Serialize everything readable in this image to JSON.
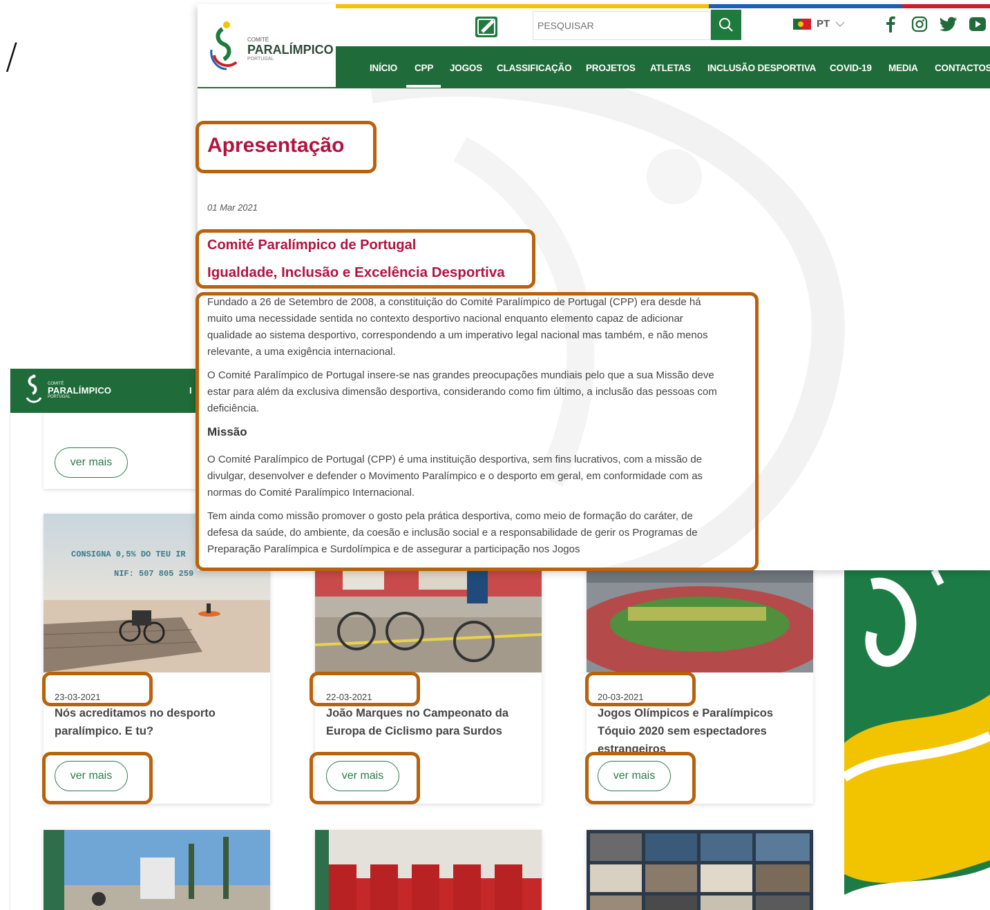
{
  "decor": {
    "slash": "/"
  },
  "background_page": {
    "logo": {
      "small": "COMITÉ",
      "big": "PARALÍMPICO",
      "sub": "PORTUGAL"
    },
    "nav_stub": "I",
    "top_card_button": "ver mais",
    "cards": [
      {
        "date": "23-03-2021",
        "title": "Nós acreditamos no desporto paralímpico. E tu?",
        "button": "ver mais",
        "image_text_1": "CONSIGNA 0,5% DO TEU IR",
        "image_text_2": "NIF: 507 805 259"
      },
      {
        "date": "22-03-2021",
        "title": "João Marques no Campeonato da Europa de Ciclismo para Surdos",
        "button": "ver mais"
      },
      {
        "date": "20-03-2021",
        "title": "Jogos Olímpicos e Paralímpicos Tóquio 2020 sem espectadores estrangeiros",
        "button": "ver mais"
      }
    ]
  },
  "foreground_page": {
    "logo": {
      "small": "COMITÉ",
      "big": "PARALÍMPICO",
      "sub": "PORTUGAL"
    },
    "search": {
      "placeholder": "PESQUISAR"
    },
    "language": "PT",
    "nav": [
      "INÍCIO",
      "CPP",
      "JOGOS",
      "CLASSIFICAÇÃO",
      "PROJETOS",
      "ATLETAS",
      "INCLUSÃO DESPORTIVA",
      "COVID-19",
      "MEDIA",
      "CONTACTOS"
    ],
    "nav_active": "CPP",
    "social_icons": [
      "facebook-icon",
      "instagram-icon",
      "twitter-icon",
      "youtube-icon"
    ],
    "title": "Apresentação",
    "date": "01 Mar 2021",
    "heading": "Comité Paralímpico de Portugal",
    "subheading": "Igualdade, Inclusão e Excelência Desportiva",
    "paragraphs": [
      "Fundado a 26 de Setembro de 2008, a constituição do Comité Paralímpico de Portugal (CPP) era desde há muito uma necessidade sentida no contexto desportivo nacional enquanto elemento capaz de adicionar qualidade ao sistema desportivo, correspondendo a um imperativo legal nacional mas também, e não menos relevante, a uma exigência internacional.",
      "O Comité Paralímpico de Portugal insere-se nas grandes preocupações mundiais pelo que a sua Missão deve estar para além da exclusiva dimensão desportiva, considerando como fim último, a inclusão das pessoas com deficiência."
    ],
    "mission_heading": "Missão",
    "mission_paragraphs": [
      "O Comité Paralímpico de Portugal (CPP) é uma instituição desportiva, sem fins lucrativos, com a missão de divulgar, desenvolver e defender o Movimento Paralímpico e o desporto em geral, em conformidade com as normas do Comité Paralímpico Internacional.",
      "Tem ainda como missão promover o gosto pela prática desportiva, como meio de formação do caráter, de defesa da saúde, do ambiente, da coesão e inclusão social e a responsabilidade de gerir os Programas de Preparação Paralímpica e Surdolímpica e de assegurar a participação nos Jogos"
    ]
  },
  "colors": {
    "brand_green": "#1f6b39",
    "title_red": "#b3123f",
    "highlight_orange": "#b8620c"
  }
}
